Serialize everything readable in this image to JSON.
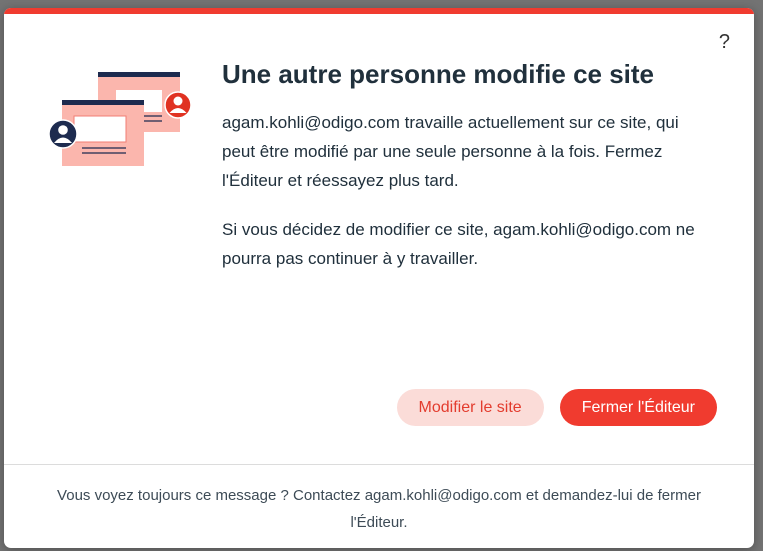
{
  "help_label": "?",
  "title": "Une autre personne modifie ce site",
  "message": {
    "paragraph1": "agam.kohli@odigo.com travaille actuellement sur ce site, qui peut être modifié par une seule personne à la fois. Fermez l'Éditeur et réessayez plus tard.",
    "paragraph2": "Si vous décidez de modifier ce site, agam.kohli@odigo.com ne pourra pas continuer à y travailler."
  },
  "buttons": {
    "edit_site": "Modifier le site",
    "close_editor": "Fermer l'Éditeur"
  },
  "footer_text": "Vous voyez toujours ce message ? Contactez agam.kohli@odigo.com et demandez-lui de fermer l'Éditeur.",
  "colors": {
    "accent": "#f03b2f",
    "secondary_button_bg": "#fbdcd8",
    "illustration_pink": "#fbb6ad",
    "illustration_navy": "#1d2b4f",
    "title_text": "#20303c"
  },
  "illustration": {
    "icons": [
      "browser-window-icon",
      "user-avatar-icon"
    ]
  }
}
